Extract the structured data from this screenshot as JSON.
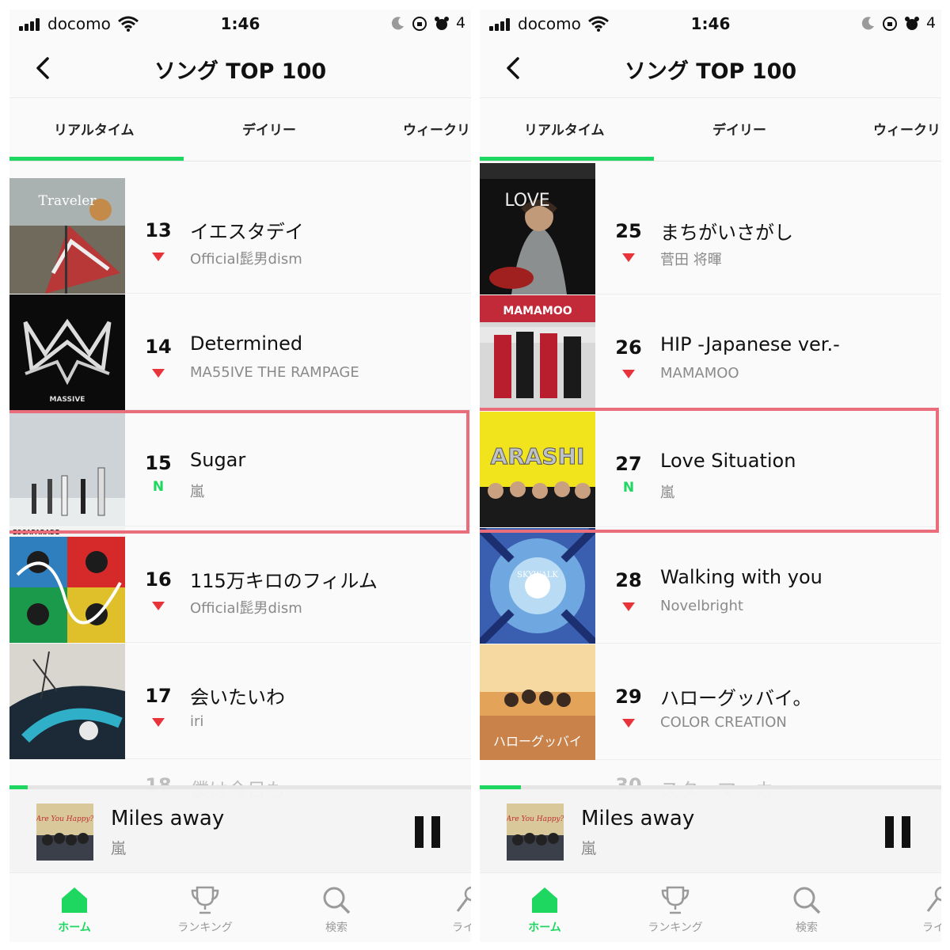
{
  "screens": [
    {
      "status": {
        "carrier": "docomo",
        "time": "1:46",
        "battery": "4"
      },
      "header": {
        "title": "ソング TOP 100"
      },
      "tabs": [
        "リアルタイム",
        "デイリー",
        "ウィークリ"
      ],
      "rows": [
        {
          "rank": "13",
          "title": "イエスタデイ",
          "artist": "Official髭男dism",
          "trend": "down",
          "art_text": "Traveler"
        },
        {
          "rank": "14",
          "title": "Determined",
          "artist": "MA55IVE THE RAMPAGE",
          "trend": "down",
          "art_text": "MASSIVE"
        },
        {
          "rank": "15",
          "title": "Sugar",
          "artist": "嵐",
          "trend": "N",
          "highlighted": true
        },
        {
          "rank": "16",
          "title": "115万キロのフィルム",
          "artist": "Official髭男dism",
          "trend": "down",
          "art_text": "ESCAPARADE"
        },
        {
          "rank": "17",
          "title": "会いたいわ",
          "artist": "iri",
          "trend": "down"
        }
      ],
      "ghost_row": {
        "rank": "18",
        "title": "僕は今日も"
      },
      "player": {
        "title": "Miles away",
        "artist": "嵐",
        "progress": 0.04,
        "art_text": "Are You Happy?"
      },
      "nav": [
        "ホーム",
        "ランキング",
        "検索",
        "ライブ"
      ]
    },
    {
      "status": {
        "carrier": "docomo",
        "time": "1:46",
        "battery": "4"
      },
      "header": {
        "title": "ソング TOP 100"
      },
      "tabs": [
        "リアルタイム",
        "デイリー",
        "ウィークリ"
      ],
      "rows": [
        {
          "rank": "25",
          "title": "まちがいさがし",
          "artist": "菅田 将暉",
          "trend": "down",
          "art_text": "LOVE"
        },
        {
          "rank": "26",
          "title": "HIP -Japanese ver.-",
          "artist": "MAMAMOO",
          "trend": "down",
          "art_text": "MAMAMOO"
        },
        {
          "rank": "27",
          "title": "Love Situation",
          "artist": "嵐",
          "trend": "N",
          "highlighted": true,
          "art_text": "ARASHI"
        },
        {
          "rank": "28",
          "title": "Walking with you",
          "artist": "Novelbright",
          "trend": "down",
          "art_text": "SKYWALK"
        },
        {
          "rank": "29",
          "title": "ハローグッバイ。",
          "artist": "COLOR CREATION",
          "trend": "down",
          "art_text": "ハローグッバイ"
        }
      ],
      "ghost_row": {
        "rank": "30",
        "title": "スターマーカー"
      },
      "player": {
        "title": "Miles away",
        "artist": "嵐",
        "progress": 0.09,
        "art_text": "Are You Happy?"
      },
      "nav": [
        "ホーム",
        "ランキング",
        "検索",
        "ライブ"
      ]
    }
  ],
  "colors": {
    "accent": "#1ed760",
    "down": "#e8333a",
    "highlight": "#ea6d7b"
  },
  "icons": [
    "back-chevron-icon",
    "wifi-icon",
    "moon-icon",
    "alarm-icon",
    "pause-icon",
    "home-icon",
    "trophy-icon",
    "search-icon",
    "live-icon"
  ]
}
